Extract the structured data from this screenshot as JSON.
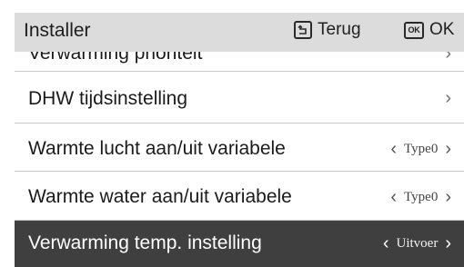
{
  "header": {
    "title": "Installer",
    "back_label": "Terug",
    "ok_icon_text": "OK",
    "ok_label": "OK"
  },
  "list": {
    "items": [
      {
        "label": "Verwarming prioriteit"
      },
      {
        "label": "DHW tijdsinstelling"
      },
      {
        "label": "Warmte lucht aan/uit variabele",
        "value": "Type0"
      },
      {
        "label": "Warmte water aan/uit variabele",
        "value": "Type0"
      },
      {
        "label": "Verwarming temp. instelling",
        "value": "Uitvoer"
      }
    ]
  },
  "icons": {
    "back": "back-return-icon",
    "ok": "ok-key-icon",
    "chevron_right": "chevron-right-icon",
    "chevron_left": "chevron-left-icon"
  },
  "colors": {
    "header_bg": "#dcdcdc",
    "selected_row_bg": "#3f3f3f",
    "row_divider": "#c8c8c8"
  }
}
